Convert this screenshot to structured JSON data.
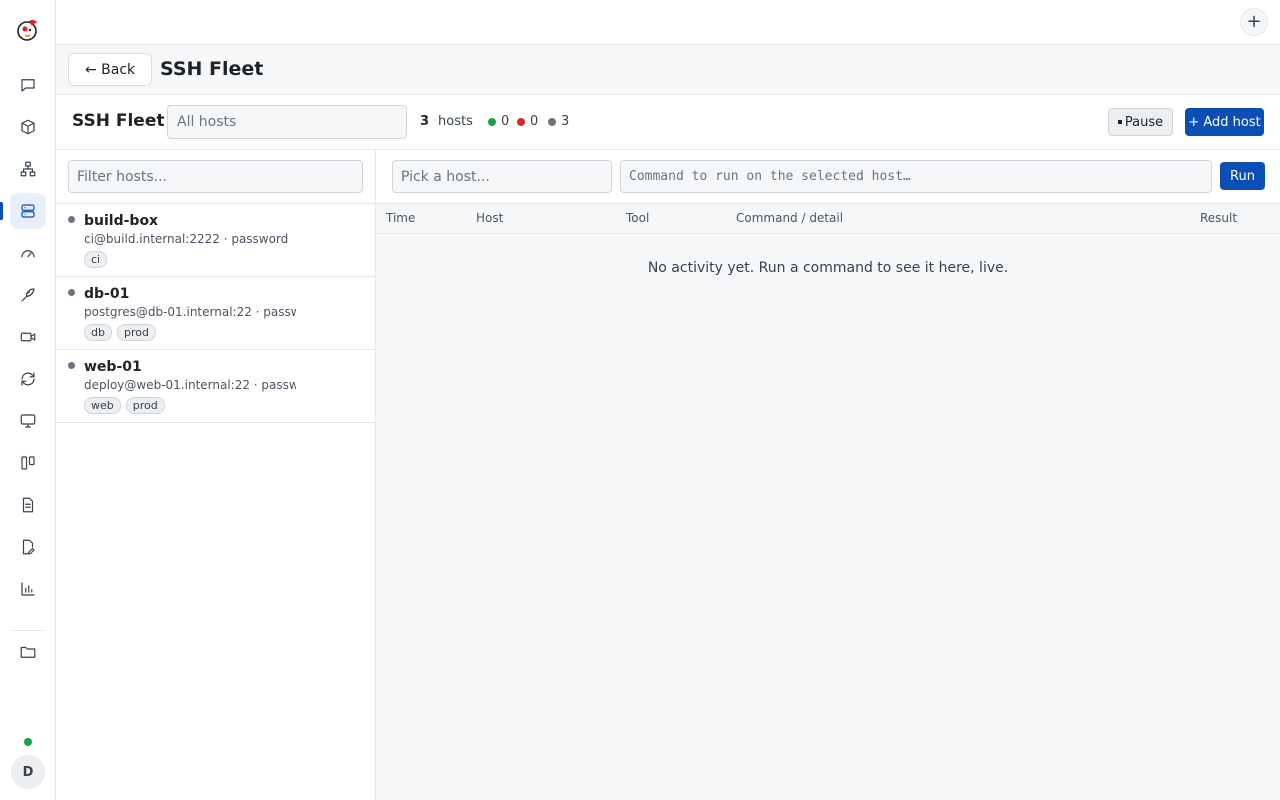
{
  "topbar": {
    "new_button": "+"
  },
  "header": {
    "back_label": "← Back",
    "title": "SSH Fleet"
  },
  "toolbar": {
    "title": "SSH Fleet",
    "host_filter_value": "All hosts",
    "host_count": "3",
    "host_count_label": "hosts",
    "stats": [
      {
        "color": "#16a34a",
        "value": "0"
      },
      {
        "color": "#dc2626",
        "value": "0"
      },
      {
        "color": "#6b7280",
        "value": "3"
      }
    ],
    "pause_label": "Pause",
    "add_label": "+ Add host"
  },
  "host_list": {
    "filter_placeholder": "Filter hosts...",
    "hosts": [
      {
        "name": "build-box",
        "detail": "ci@build.internal:2222 · password",
        "tags": [
          "ci"
        ]
      },
      {
        "name": "db-01",
        "detail": "postgres@db-01.internal:22 · passw...",
        "tags": [
          "db",
          "prod"
        ]
      },
      {
        "name": "web-01",
        "detail": "deploy@web-01.internal:22 · passw...",
        "tags": [
          "web",
          "prod"
        ]
      }
    ]
  },
  "command": {
    "pick_host_placeholder": "Pick a host...",
    "command_placeholder": "Command to run on the selected host…",
    "run_label": "Run"
  },
  "activity": {
    "columns": [
      "Time",
      "Host",
      "Tool",
      "Command / detail",
      "Result"
    ],
    "empty_message": "No activity yet. Run a command to see it here, live."
  },
  "user": {
    "avatar_initial": "D"
  },
  "colors": {
    "accent": "#0b4fb5",
    "online": "#16a34a",
    "error": "#dc2626",
    "unknown": "#6b7280"
  },
  "rail_icons": [
    "chat-icon",
    "box-icon",
    "network-icon",
    "server-icon",
    "gauge-icon",
    "bird-icon",
    "video-icon",
    "sync-icon",
    "monitor-icon",
    "kanban-icon",
    "document-icon",
    "edit-document-icon",
    "bar-chart-icon",
    "folder-icon"
  ]
}
